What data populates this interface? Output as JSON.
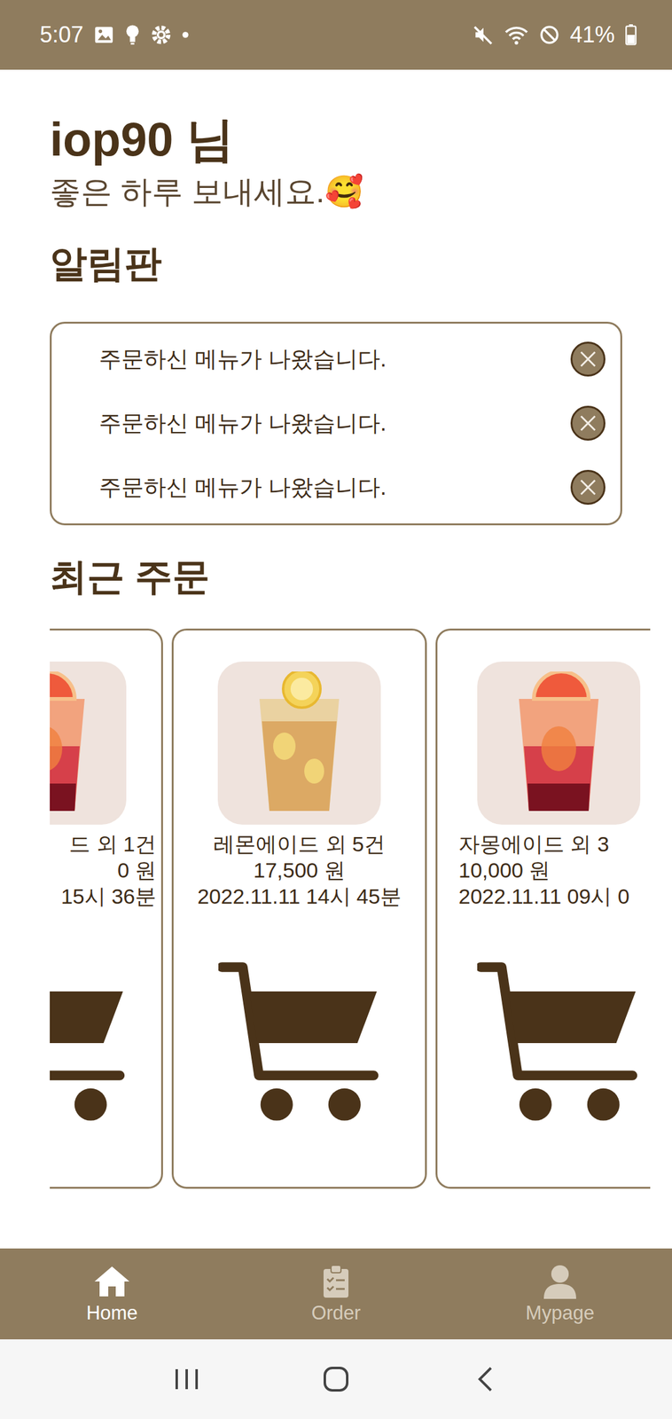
{
  "status_bar": {
    "time": "5:07",
    "battery": "41%"
  },
  "user": {
    "name": "iop90 님",
    "greeting": "좋은 하루 보내세요.🥰"
  },
  "notices": {
    "title": "알림판",
    "items": [
      {
        "text": "주문하신 메뉴가 나왔습니다."
      },
      {
        "text": "주문하신 메뉴가 나왔습니다."
      },
      {
        "text": "주문하신 메뉴가 나왔습니다."
      }
    ]
  },
  "recent_orders": {
    "title": "최근 주문",
    "items": [
      {
        "kind": "grapefruit",
        "lines": [
          "드 외 1건",
          "0 원",
          "15시 36분"
        ]
      },
      {
        "kind": "lemon",
        "lines": [
          "레몬에이드 외 5건",
          "17,500 원",
          "2022.11.11 14시 45분"
        ]
      },
      {
        "kind": "grapefruit",
        "lines": [
          "자몽에이드 외 3",
          "10,000 원",
          "2022.11.11 09시 0"
        ]
      }
    ]
  },
  "bottom_nav": [
    {
      "label": "Home",
      "selected": true
    },
    {
      "label": "Order",
      "selected": false
    },
    {
      "label": "Mypage",
      "selected": false
    }
  ]
}
